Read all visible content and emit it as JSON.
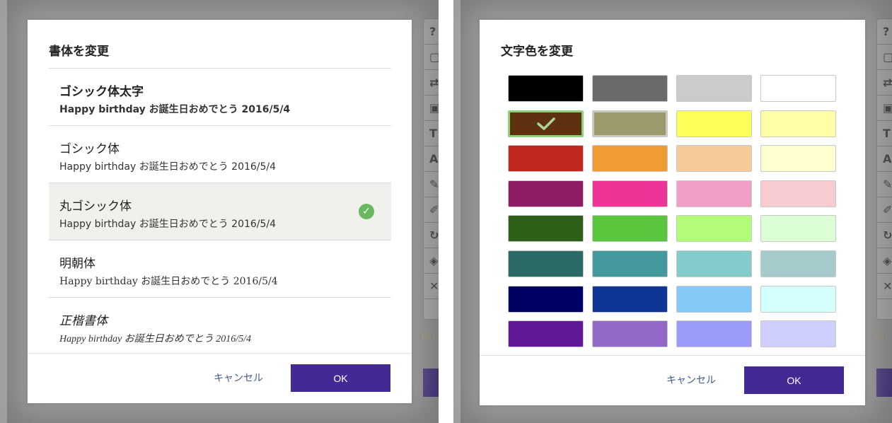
{
  "font_dialog": {
    "title": "書体を変更",
    "items": [
      {
        "name": "ゴシック体太字",
        "sample": "Happy birthday お誕生日おめでとう 2016/5/4",
        "selected": false,
        "style": "bold"
      },
      {
        "name": "ゴシック体",
        "sample": "Happy birthday お誕生日おめでとう 2016/5/4",
        "selected": false,
        "style": "normal"
      },
      {
        "name": "丸ゴシック体",
        "sample": "Happy birthday お誕生日おめでとう 2016/5/4",
        "selected": true,
        "style": "normal"
      },
      {
        "name": "明朝体",
        "sample": "Happy birthday お誕生日おめでとう 2016/5/4",
        "selected": false,
        "style": "serif"
      },
      {
        "name": "正楷書体",
        "sample": "Happy birthday お誕生日おめでとう 2016/5/4",
        "selected": false,
        "style": "kaisho"
      }
    ],
    "cancel_label": "キャンセル",
    "ok_label": "OK"
  },
  "color_dialog": {
    "title": "文字色を変更",
    "rows": [
      [
        "#000000",
        "#6a6a6a",
        "#cbcbcb",
        "#ffffff"
      ],
      [
        "#5e3210",
        "#9a9a6a",
        "#ffff5c",
        "#ffffa6"
      ],
      [
        "#c0271f",
        "#f09c36",
        "#f6cb9c",
        "#ffffd2"
      ],
      [
        "#8e1b66",
        "#ec3596",
        "#f19ec9",
        "#f8cbd0"
      ],
      [
        "#2c6018",
        "#5ac63e",
        "#b3fc78",
        "#dcfed4"
      ],
      [
        "#2c6a68",
        "#43999b",
        "#84cbcc",
        "#a6cbcc"
      ],
      [
        "#000064",
        "#0f3597",
        "#85c9f9",
        "#d4ffff"
      ],
      [
        "#601898",
        "#9369c7",
        "#9b9bf9",
        "#cfcffe"
      ]
    ],
    "selected": [
      1,
      0
    ],
    "hover": [
      1,
      1
    ],
    "cancel_label": "キャンセル",
    "ok_label": "OK"
  },
  "colors": {
    "accent": "#432994",
    "check_green": "#66b95e",
    "link": "#3f5a8c"
  }
}
